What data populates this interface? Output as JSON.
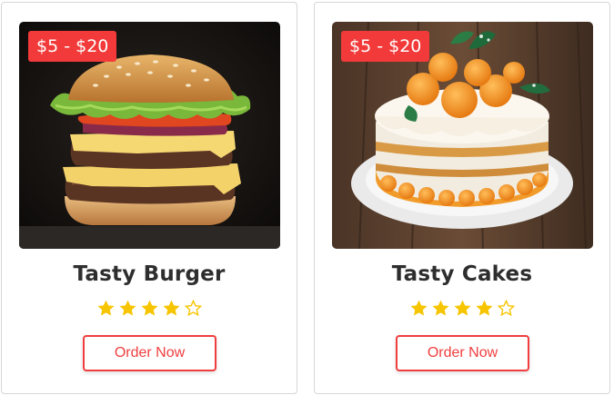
{
  "cards": [
    {
      "price": "$5 - $20",
      "title": "Tasty Burger",
      "rating": 4,
      "rating_max": 5,
      "button": "Order Now",
      "image": "burger-photo"
    },
    {
      "price": "$5 - $20",
      "title": "Tasty Cakes",
      "rating": 4,
      "rating_max": 5,
      "button": "Order Now",
      "image": "cake-photo"
    }
  ],
  "colors": {
    "accent": "#f03e3e",
    "star": "#f7c500"
  }
}
